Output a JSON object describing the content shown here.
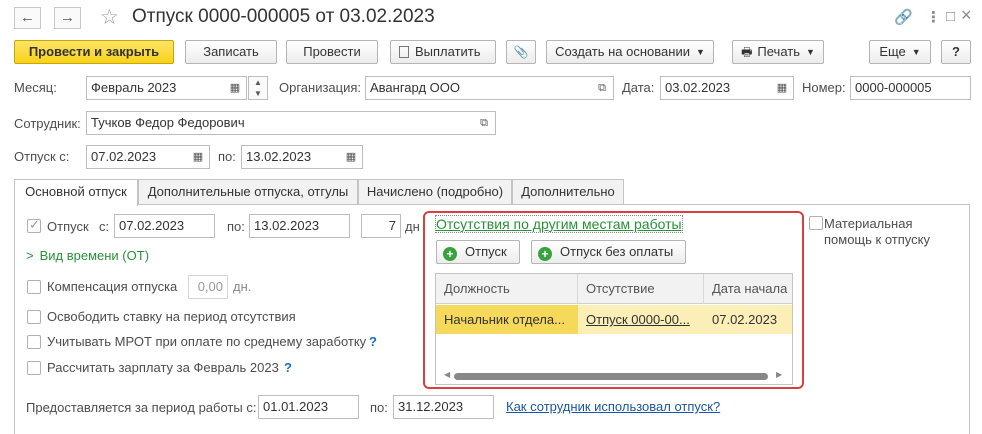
{
  "window": {
    "back_icon": "←",
    "forward_icon": "→",
    "star_icon": "☆",
    "title": "Отпуск 0000-000005 от 03.02.2023",
    "link_icon": "🔗",
    "more_icon": "⋮",
    "maximize_icon": "□",
    "close_icon": "×"
  },
  "toolbar": {
    "post_close": "Провести и закрыть",
    "save": "Записать",
    "post": "Провести",
    "pay": "Выплатить",
    "attach_icon": "📎",
    "create_based": "Создать на основании",
    "print": "Печать",
    "more": "Еще",
    "help": "?"
  },
  "header": {
    "month_label": "Месяц:",
    "month_value": "Февраль 2023",
    "org_label": "Организация:",
    "org_value": "Авангард ООО",
    "date_label": "Дата:",
    "date_value": "03.02.2023",
    "number_label": "Номер:",
    "number_value": "0000-000005",
    "employee_label": "Сотрудник:",
    "employee_value": "Тучков Федор Федорович",
    "vacation_from_label": "Отпуск с:",
    "vacation_from_value": "07.02.2023",
    "vacation_to_label": "по:",
    "vacation_to_value": "13.02.2023"
  },
  "tabs": [
    "Основной отпуск",
    "Дополнительные отпуска, отгулы",
    "Начислено (подробно)",
    "Дополнительно"
  ],
  "main": {
    "vacation_check_label": "Отпуск",
    "from_label": "с:",
    "from_value": "07.02.2023",
    "to_label": "по:",
    "to_value": "13.02.2023",
    "days_value": "7",
    "days_unit": "дн",
    "time_kind": "Вид времени (ОТ)",
    "compensation_label": "Компенсация отпуска",
    "compensation_value": "0,00",
    "compensation_unit": "дн.",
    "free_rate": "Освободить ставку на период отсутствия",
    "consider_mrot": "Учитывать МРОТ при оплате по среднему заработку",
    "calc_salary": "Рассчитать зарплату за Февраль 2023",
    "help_q": "?",
    "material_help": "Материальная помощь к отпуску",
    "period_label": "Предоставляется за период работы с:",
    "period_from": "01.01.2023",
    "period_to_label": "по:",
    "period_to": "31.12.2023",
    "how_used_link": "Как сотрудник использовал отпуск?"
  },
  "absences": {
    "title": "Отсутствия по другим местам работы",
    "btn_vacation": "Отпуск",
    "btn_unpaid": "Отпуск без оплаты",
    "columns": [
      "Должность",
      "Отсутствие",
      "Дата начала"
    ],
    "rows": [
      [
        "Начальник отдела...",
        "Отпуск 0000-00...",
        "07.02.2023"
      ]
    ]
  },
  "colors": {
    "primary_button": "#f7d21a",
    "highlight_border": "#d64040",
    "selected_row": "#fbeeb6",
    "green": "#2a9138",
    "link": "#1b57a0"
  }
}
